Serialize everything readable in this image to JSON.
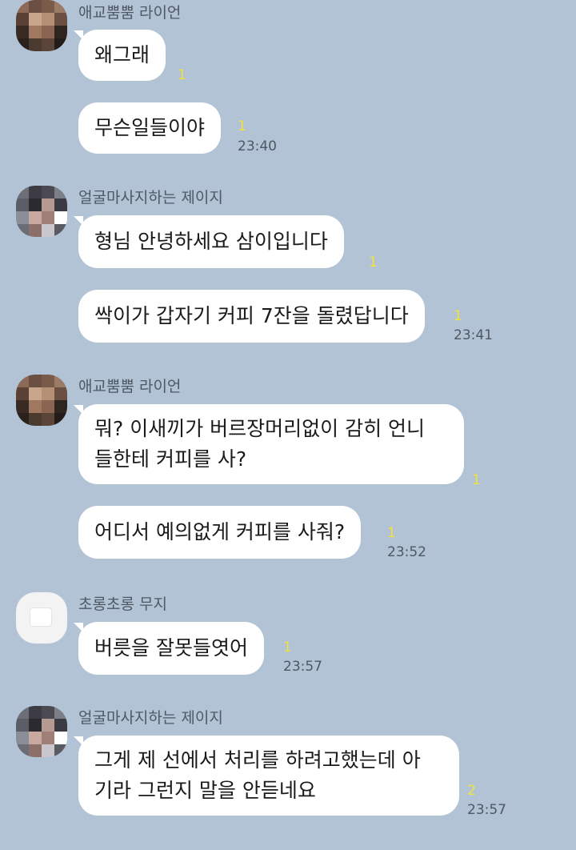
{
  "messages": [
    {
      "sender": "애교뿜뿜 라이언",
      "text": "왜그래",
      "unread": "1",
      "time": ""
    },
    {
      "sender": "",
      "text": "무슨일들이야",
      "unread": "1",
      "time": "23:40"
    },
    {
      "sender": "얼굴마사지하는 제이지",
      "text": "형님 안녕하세요 삼이입니다",
      "unread": "1",
      "time": ""
    },
    {
      "sender": "",
      "text": "싹이가 갑자기 커피 7잔을 돌렸답니다",
      "unread": "1",
      "time": "23:41"
    },
    {
      "sender": "애교뿜뿜 라이언",
      "text_line1": "뭐? 이새끼가 버르장머리없이 감히 언니",
      "text_line2": "들한테 커피를 사?",
      "unread": "1",
      "time": ""
    },
    {
      "sender": "",
      "text": "어디서 예의없게 커피를 사줘?",
      "unread": "1",
      "time": "23:52"
    },
    {
      "sender": "초롱초롱 무지",
      "text": "버릇을 잘못들엿어",
      "unread": "1",
      "time": "23:57"
    },
    {
      "sender": "얼굴마사지하는 제이지",
      "text_line1": "그게 제 선에서 처리를 하려고했는데 아",
      "text_line2": "기라 그런지 말을 안듣네요",
      "unread": "2",
      "time": "23:57"
    }
  ],
  "colors": {
    "background": "#b1c3d5",
    "bubble": "#ffffff",
    "unread": "#f2e23b",
    "meta_text": "#4f5863"
  }
}
